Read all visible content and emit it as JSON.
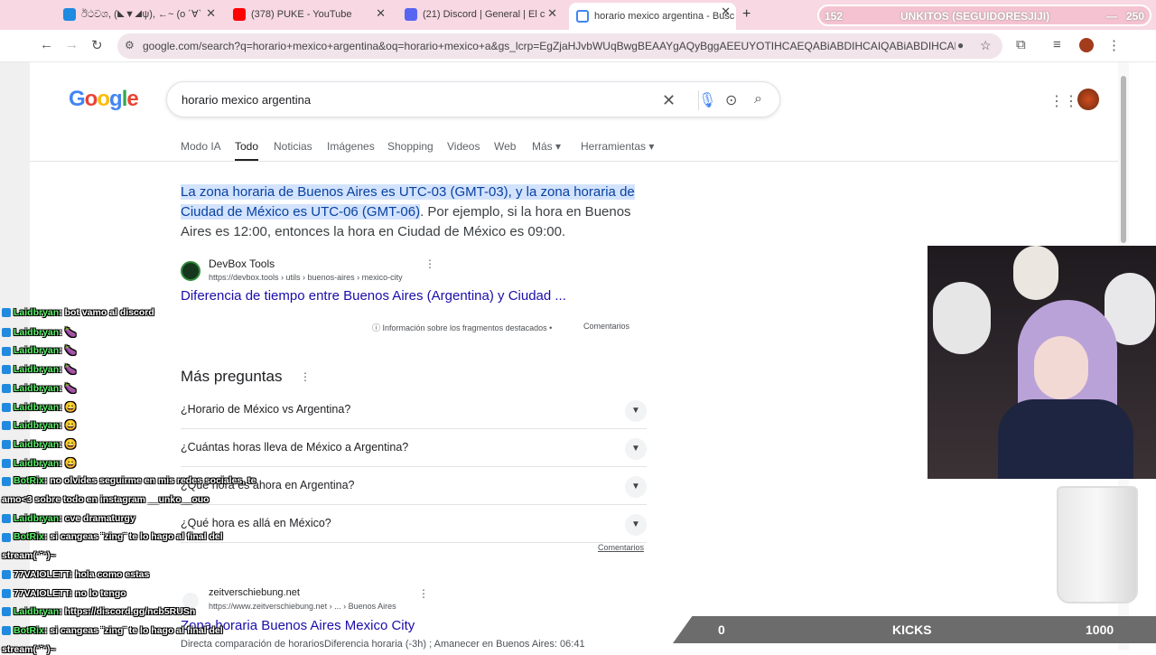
{
  "browser": {
    "tabs": [
      {
        "title": "ඊථවශ, (◣▼◢ψ), ←~ (o ´∀`",
        "color": "#1f8ae0"
      },
      {
        "title": "(378) PUKE - YouTube",
        "color": "#ff0000"
      },
      {
        "title": "(21) Discord | General | El c",
        "color": "#5865f2"
      },
      {
        "title": "horario mexico argentina - Busc",
        "color": "#4285f4"
      }
    ],
    "url": "google.com/search?q=horario+mexico+argentina&oq=horario+mexico+a&gs_lcrp=EgZjaHJvbWUqBwgBEAAYgAQyBggAEEUYOTIHCAEQABiABDIHCAIQABiABDIHCAMQABiABDIHC..."
  },
  "overlay": {
    "followers_current": "152",
    "followers_label": "UNKITOS (SEGUIDORESJIJI)",
    "followers_goal": "250",
    "kicks_current": "0",
    "kicks_label": "KICKS",
    "kicks_goal": "1000"
  },
  "google": {
    "logo": "Google",
    "query": "horario mexico argentina",
    "tabs": [
      "Modo IA",
      "Todo",
      "Noticias",
      "Imágenes",
      "Shopping",
      "Videos",
      "Web",
      "Más ▾",
      "Herramientas ▾"
    ],
    "snippet_highlight": "La zona horaria de Buenos Aires es UTC-03 (GMT-03), y la zona horaria de Ciudad de México es UTC-06 (GMT-06)",
    "snippet_rest": ". Por ejemplo, si la hora en Buenos Aires es 12:00, entonces la hora en Ciudad de México es 09:00.",
    "source_name": "DevBox Tools",
    "source_url": "https://devbox.tools › utils › buenos-aires › mexico-city",
    "result_title": "Diferencia de tiempo entre Buenos Aires (Argentina) y Ciudad ...",
    "featured_info": "Información sobre los fragmentos destacados",
    "featured_comments": "Comentarios",
    "paa_title": "Más preguntas",
    "paa": [
      "¿Horario de México vs Argentina?",
      "¿Cuántas horas lleva de México a Argentina?",
      "¿Qué hora es ahora en Argentina?",
      "¿Qué hora es allá en México?"
    ],
    "paa_comments": "Comentarios",
    "result2_name": "zeitverschiebung.net",
    "result2_url": "https://www.zeitverschiebung.net › ... › Buenos Aires",
    "result2_title": "Zona horaria Buenos Aires Mexico City",
    "result2_desc": "Directa comparación de horariosDiferencia horaria (-3h) ; Amanecer en Buenos Aires: 06:41"
  },
  "chat": [
    {
      "user": "Laidbryan",
      "msg": ": bot vamo al discord"
    },
    {
      "user": "Laidbryan",
      "msg": ": 🍆"
    },
    {
      "user": "Laidbryan",
      "msg": ": 🍆"
    },
    {
      "user": "Laidbryan",
      "msg": ": 🍆"
    },
    {
      "user": "Laidbryan",
      "msg": ": 🍆"
    },
    {
      "user": "Laidbryan",
      "msg": ": 😄"
    },
    {
      "user": "Laidbryan",
      "msg": ": 😄"
    },
    {
      "user": "Laidbryan",
      "msg": ": 😄"
    },
    {
      "user": "Laidbryan",
      "msg": ": 😄"
    },
    {
      "user": "BotRix",
      "msg": ": no olvides seguirme en mis redes sociales, te"
    },
    {
      "user": "",
      "msg": "amo<3 sobre todo en instagram __unko__ouo"
    },
    {
      "user": "Laidbryan",
      "msg": ": cve dramaturgy"
    },
    {
      "user": "BotRix",
      "msg": ": si cangeas ¨zing¨ te lo hago al final del"
    },
    {
      "user": "",
      "msg": "stream(ᵔ˘ᵔ)~"
    },
    {
      "user": "77VAIOLETT",
      "msg": ": hola como estas"
    },
    {
      "user": "77VAIOLETT",
      "msg": ": no lo tengo"
    },
    {
      "user": "Laidbryan",
      "msg": ": https://discord.gg/ncb5RUSn"
    },
    {
      "user": "BotRix",
      "msg": ": si cangeas ¨zing¨ te lo hago al final del"
    },
    {
      "user": "",
      "msg": "stream(ᵔ˘ᵔ)~"
    }
  ]
}
